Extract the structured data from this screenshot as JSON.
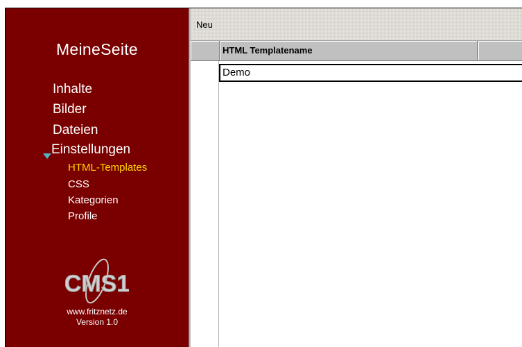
{
  "sidebar": {
    "brand": "MeineSeite",
    "main_items": [
      {
        "label": "Inhalte"
      },
      {
        "label": "Bilder"
      },
      {
        "label": "Dateien"
      },
      {
        "label": "Einstellungen"
      }
    ],
    "sub_items": [
      {
        "label": "HTML-Templates",
        "active": true
      },
      {
        "label": "CSS"
      },
      {
        "label": "Kategorien"
      },
      {
        "label": "Profile"
      }
    ],
    "logo_text": "CMS1",
    "footer_url": "www.fritznetz.de",
    "footer_version": "Version 1.0"
  },
  "toolbar": {
    "new_label": "Neu"
  },
  "grid": {
    "column_header": "HTML Templatename",
    "rows": [
      {
        "name": "Demo"
      }
    ]
  },
  "colors": {
    "sidebar_bg": "#7a0000",
    "active_item": "#ffd700",
    "expand_arrow": "#4fb3c4"
  }
}
